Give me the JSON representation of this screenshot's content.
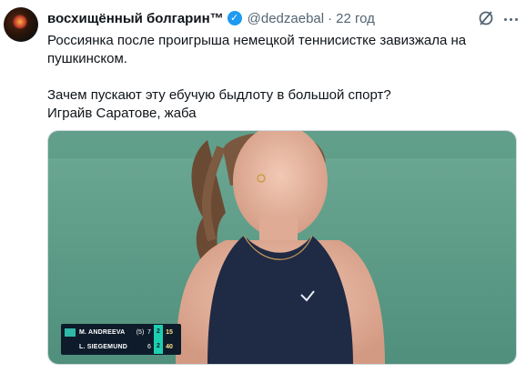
{
  "tweet": {
    "display_name": "восхищённый болгарин™",
    "verified_mark": "✓",
    "handle": "@dedzaebal",
    "separator": "·",
    "time": "22 год",
    "text_lines": [
      "Россиянка после проигрыша немецкой теннисистке завизжала на",
      "пушкинском.",
      "Зачем пускают эту ебучую быдлоту в большой спорт?",
      "Играйв Саратове, жаба"
    ]
  },
  "media": {
    "scoreboard": {
      "player1": {
        "name": "M. ANDREEVA",
        "seed": "(5)",
        "set1": "7",
        "set2": "2",
        "points": "15"
      },
      "player2": {
        "name": "L. SIEGEMUND",
        "set1": "6",
        "set2": "2",
        "points": "40"
      }
    }
  },
  "colors": {
    "verified": "#1d9bf0",
    "muted_text": "#536471",
    "court": "#5c9a86"
  },
  "icons": [
    "grok-icon",
    "more-icon",
    "verified-icon",
    "avatar"
  ]
}
